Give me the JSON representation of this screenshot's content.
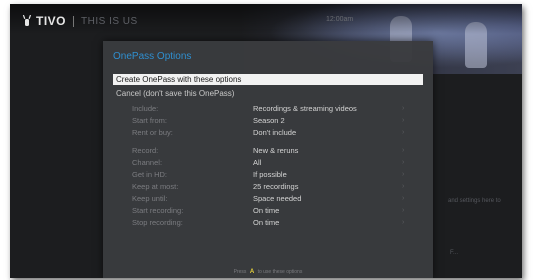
{
  "header": {
    "brand": "TIVO",
    "show_title": "THIS IS US",
    "top_right": "12:00am"
  },
  "dialog": {
    "title": "OnePass Options",
    "primary_action": "Create OnePass with these options",
    "cancel_action": "Cancel (don't save this OnePass)",
    "options": [
      {
        "label": "Include:",
        "value": "Recordings & streaming videos"
      },
      {
        "label": "Start from:",
        "value": "Season 2"
      },
      {
        "label": "Rent or buy:",
        "value": "Don't include"
      },
      {
        "label": "Record:",
        "value": "New & reruns"
      },
      {
        "label": "Channel:",
        "value": "All"
      },
      {
        "label": "Get in HD:",
        "value": "If possible"
      },
      {
        "label": "Keep at most:",
        "value": "25 recordings"
      },
      {
        "label": "Keep until:",
        "value": "Space needed"
      },
      {
        "label": "Start recording:",
        "value": "On time"
      },
      {
        "label": "Stop recording:",
        "value": "On time"
      }
    ],
    "footer_prefix": "Press",
    "footer_key": "A",
    "footer_suffix": "to use these options"
  },
  "background": {
    "side_note": "and settings here to",
    "side_note2": "F..."
  }
}
